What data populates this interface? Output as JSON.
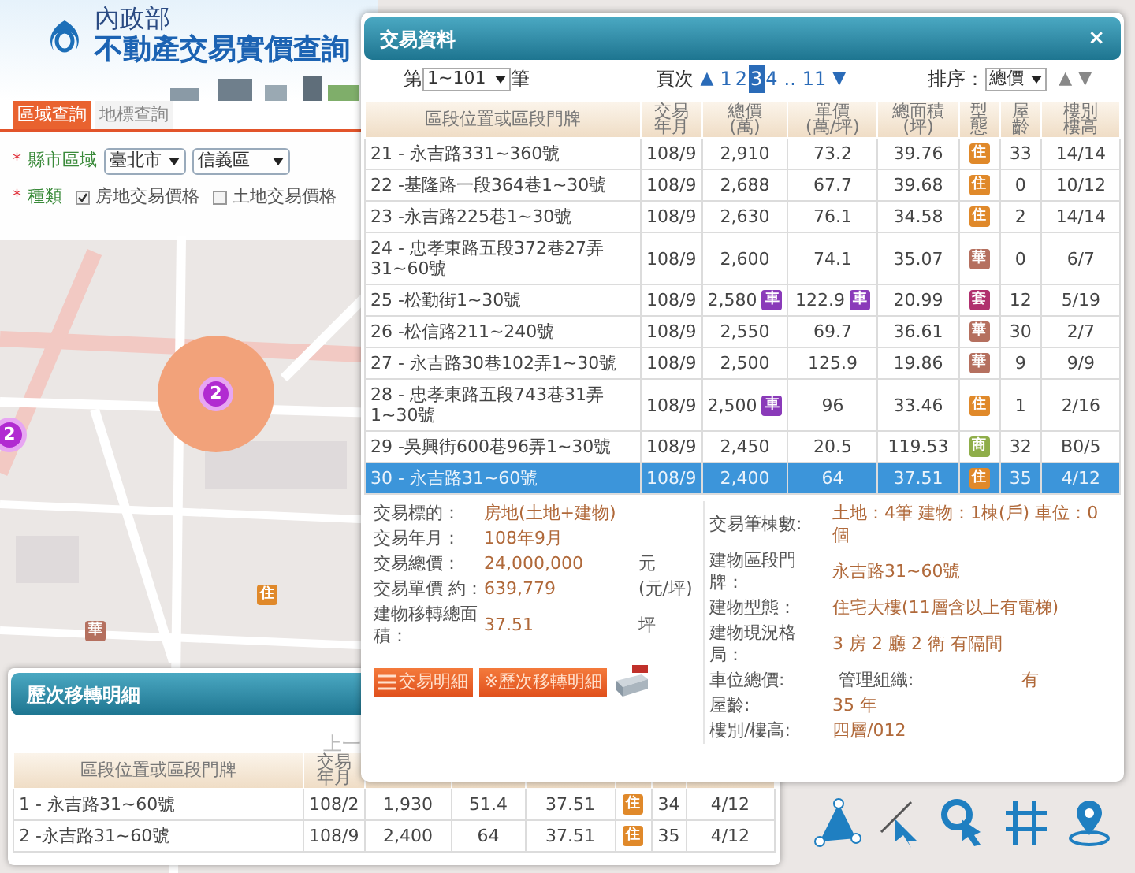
{
  "header": {
    "ministry": "內政部",
    "title": "不動產交易實價查詢"
  },
  "search_tabs": [
    {
      "label": "區域查詢",
      "selected": true
    },
    {
      "label": "地標查詢",
      "selected": false
    }
  ],
  "region": {
    "mark": "*",
    "label": "縣市區域",
    "city": "臺北市",
    "district": "信義區"
  },
  "category": {
    "mark": "*",
    "label": "種類",
    "options": [
      {
        "label": "房地交易價格",
        "checked": true
      },
      {
        "label": "土地交易價格",
        "checked": false
      }
    ]
  },
  "map": {
    "clusters": [
      {
        "count": "2",
        "kind": "highlighted"
      },
      {
        "count": "2",
        "kind": "plain"
      }
    ],
    "markers": [
      {
        "label": "住",
        "color": "#e0892a"
      },
      {
        "label": "華",
        "color": "#b5705f"
      }
    ]
  },
  "transactions": {
    "title": "交易資料",
    "close": "×",
    "range": {
      "prefix": "第",
      "value": "1~101",
      "suffix": "筆"
    },
    "pager": {
      "label": "頁次",
      "prev": "▲",
      "next": "▼",
      "pages": [
        {
          "label": "1",
          "kind": "page",
          "selected": false
        },
        {
          "label": "2",
          "kind": "page",
          "selected": false
        },
        {
          "label": "3",
          "kind": "page",
          "selected": true
        },
        {
          "label": "4",
          "kind": "page",
          "selected": false
        },
        {
          "label": "..",
          "kind": "gap"
        },
        {
          "label": "11",
          "kind": "page",
          "selected": false
        }
      ]
    },
    "sort": {
      "label": "排序：",
      "value": "總價",
      "asc": "▲",
      "desc": "▼"
    },
    "columns": [
      [
        "區段位置或區段門牌"
      ],
      [
        "交易",
        "年月"
      ],
      [
        "總價",
        "(萬)"
      ],
      [
        "單價",
        "(萬/坪)"
      ],
      [
        "總面積",
        "(坪)"
      ],
      [
        "型",
        "態"
      ],
      [
        "屋",
        "齡"
      ],
      [
        "樓別",
        "樓高"
      ]
    ],
    "rows": [
      {
        "address": "21 - 永吉路331~360號",
        "ym": "108/9",
        "price": "2,910",
        "unit": "73.2",
        "area": "39.76",
        "type": {
          "label": "住",
          "color": "#e0892a"
        },
        "age": "33",
        "floor": "14/14",
        "selected": false
      },
      {
        "address": "22 -基隆路一段364巷1~30號",
        "ym": "108/9",
        "price": "2,688",
        "unit": "67.7",
        "area": "39.68",
        "type": {
          "label": "住",
          "color": "#e0892a"
        },
        "age": "0",
        "floor": "10/12",
        "selected": false
      },
      {
        "address": "23 -永吉路225巷1~30號",
        "ym": "108/9",
        "price": "2,630",
        "unit": "76.1",
        "area": "34.58",
        "type": {
          "label": "住",
          "color": "#e0892a"
        },
        "age": "2",
        "floor": "14/14",
        "selected": false
      },
      {
        "address": "24 - 忠孝東路五段372巷27弄31~60號",
        "ym": "108/9",
        "price": "2,600",
        "unit": "74.1",
        "area": "35.07",
        "type": {
          "label": "華",
          "color": "#b5705f"
        },
        "age": "0",
        "floor": "6/7",
        "selected": false
      },
      {
        "address": "25 -松勤街1~30號",
        "ym": "108/9",
        "price": "2,580",
        "price_tag": "車",
        "unit": "122.9",
        "unit_tag": "車",
        "area": "20.99",
        "type": {
          "label": "套",
          "color": "#b0306e"
        },
        "age": "12",
        "floor": "5/19",
        "selected": false
      },
      {
        "address": "26 -松信路211~240號",
        "ym": "108/9",
        "price": "2,550",
        "unit": "69.7",
        "area": "36.61",
        "type": {
          "label": "華",
          "color": "#b5705f"
        },
        "age": "30",
        "floor": "2/7",
        "selected": false
      },
      {
        "address": "27 - 永吉路30巷102弄1~30號",
        "ym": "108/9",
        "price": "2,500",
        "unit": "125.9",
        "area": "19.86",
        "type": {
          "label": "華",
          "color": "#b5705f"
        },
        "age": "9",
        "floor": "9/9",
        "selected": false
      },
      {
        "address": "28 - 忠孝東路五段743巷31弄1~30號",
        "ym": "108/9",
        "price": "2,500",
        "price_tag": "車",
        "unit": "96",
        "area": "33.46",
        "type": {
          "label": "住",
          "color": "#e0892a"
        },
        "age": "1",
        "floor": "2/16",
        "selected": false
      },
      {
        "address": "29 -吳興街600巷96弄1~30號",
        "ym": "108/9",
        "price": "2,450",
        "unit": "20.5",
        "area": "119.53",
        "type": {
          "label": "商",
          "color": "#8fae4a"
        },
        "age": "32",
        "floor": "B0/5",
        "selected": false
      },
      {
        "address": "30 - 永吉路31~60號",
        "ym": "108/9",
        "price": "2,400",
        "unit": "64",
        "area": "37.51",
        "type": {
          "label": "住",
          "color": "#e0892a"
        },
        "age": "35",
        "floor": "4/12",
        "selected": true
      }
    ],
    "details_left": [
      {
        "label": "交易標的：",
        "value": "房地(土地+建物)"
      },
      {
        "label": "交易年月：",
        "value": "108年9月"
      },
      {
        "label": "交易總價：",
        "value": "24,000,000",
        "unit": "元"
      },
      {
        "label": "交易單價 約：",
        "value": "639,779",
        "unit": "(元/坪)"
      },
      {
        "label": "建物移轉總面積：",
        "value": "37.51",
        "unit": "坪"
      }
    ],
    "details_right": [
      {
        "label": "交易筆棟數:",
        "value": "土地：4筆 建物：1棟(戶) 車位：0個"
      },
      {
        "label": "建物區段門牌：",
        "value": "永吉路31~60號"
      },
      {
        "label": "建物型態：",
        "value": "住宅大樓(11層含以上有電梯)"
      },
      {
        "label": "建物現況格局：",
        "value": "3 房 2 廳 2 衛 有隔間"
      },
      {
        "label": "車位總價:",
        "sub_label": "管理組織:",
        "value": "有"
      },
      {
        "label": "屋齡:",
        "value": "35 年"
      },
      {
        "label": "樓別/樓高:",
        "value": "四層/012"
      }
    ],
    "buttons": [
      {
        "kind": "list",
        "label": "交易明細"
      },
      {
        "kind": "plain",
        "label": "※歷次移轉明細"
      }
    ]
  },
  "history": {
    "title": "歷次移轉明細",
    "prev_page": "上一",
    "columns": [
      [
        "區段位置或區段門牌"
      ],
      [
        "交易",
        "年月"
      ]
    ],
    "rows": [
      {
        "address": "1 - 永吉路31~60號",
        "ym": "108/2",
        "price": "1,930",
        "unit": "51.4",
        "area": "37.51",
        "type": {
          "label": "住",
          "color": "#e0892a"
        },
        "age": "34",
        "floor": "4/12"
      },
      {
        "address": "2 -永吉路31~60號",
        "ym": "108/9",
        "price": "2,400",
        "unit": "64",
        "area": "37.51",
        "type": {
          "label": "住",
          "color": "#e0892a"
        },
        "age": "35",
        "floor": "4/12"
      }
    ]
  }
}
